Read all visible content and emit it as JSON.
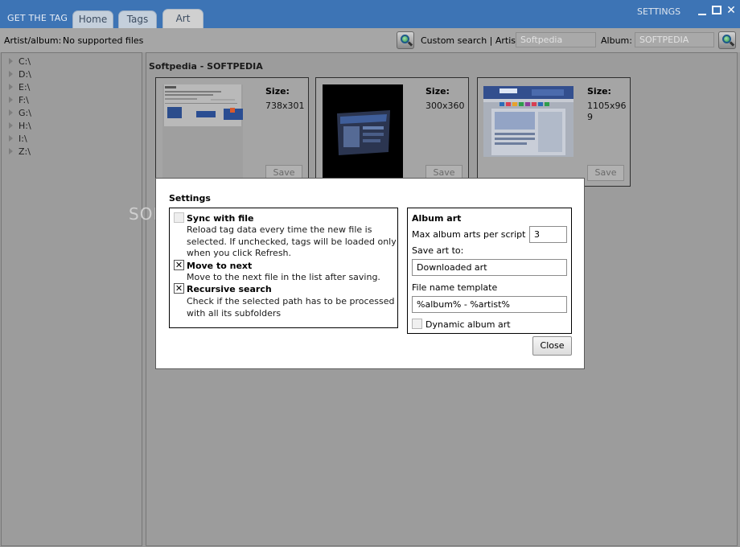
{
  "app": {
    "title": "GET THE TAG",
    "settings_link": "SETTINGS"
  },
  "tabs": [
    {
      "label": "Home"
    },
    {
      "label": "Tags"
    },
    {
      "label": "Art"
    }
  ],
  "window_controls": {
    "close": "✕"
  },
  "toolbar": {
    "artist_album_label": "Artist/album:",
    "artist_album_value": "No supported files",
    "custom_search_label": "Custom search | Artist:",
    "artist_value": "Softpedia",
    "album_label": "Album:",
    "album_value": "SOFTPEDIA"
  },
  "drives": [
    "C:\\",
    "D:\\",
    "E:\\",
    "F:\\",
    "G:\\",
    "H:\\",
    "I:\\",
    "Z:\\"
  ],
  "main": {
    "heading": "Softpedia - SOFTPEDIA",
    "art_items": [
      {
        "size_label": "Size:",
        "size_value": "738x301",
        "save_label": "Save"
      },
      {
        "size_label": "Size:",
        "size_value": "300x360",
        "save_label": "Save"
      },
      {
        "size_label": "Size:",
        "size_value": "1105x969",
        "save_label": "Save"
      }
    ]
  },
  "watermark": "SOFTPEDIA",
  "settings_dialog": {
    "title": "Settings",
    "options": [
      {
        "title": "Sync with file",
        "checked": false,
        "enabled": false,
        "description": "Reload tag data every time the new file is selected. If unchecked, tags will be loaded only when you click Refresh."
      },
      {
        "title": "Move to next",
        "checked": true,
        "enabled": true,
        "description": "Move to the next file in the list after saving."
      },
      {
        "title": "Recursive search",
        "checked": true,
        "enabled": true,
        "description": "Check if the selected path has to be processed with all its subfolders"
      }
    ],
    "album_art": {
      "title": "Album art",
      "max_label": "Max album arts per script",
      "max_value": "3",
      "save_to_label": "Save art to:",
      "save_to_value": "Downloaded art",
      "template_label": "File name template",
      "template_value": "%album% - %artist%",
      "dynamic_label": "Dynamic album art",
      "dynamic_checked": false
    },
    "close_label": "Close",
    "check_mark": "✕"
  }
}
